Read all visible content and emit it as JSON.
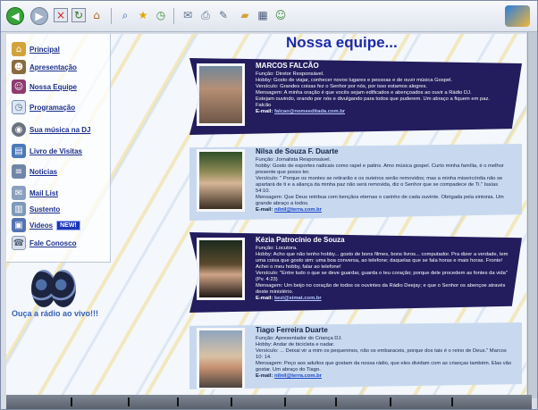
{
  "page": {
    "title": "Nossa equipe...",
    "radio_text": "Ouça a rádio ao vivo!!!"
  },
  "sidebar": {
    "items": [
      {
        "label": "Principal",
        "icon": "house-icon"
      },
      {
        "label": "Apresentação",
        "icon": "people-icon"
      },
      {
        "label": "Nossa Equipe",
        "icon": "team-icon"
      },
      {
        "label": "Programação",
        "icon": "schedule-icon"
      },
      {
        "label": "Sua música na DJ",
        "icon": "disc-icon"
      },
      {
        "label": "Livro de Visitas",
        "icon": "book-icon"
      },
      {
        "label": "Noticias",
        "icon": "news-icon"
      },
      {
        "label": "Mail List",
        "icon": "mail-icon"
      },
      {
        "label": "Sustento",
        "icon": "support-icon"
      },
      {
        "label": "Videos",
        "icon": "video-icon",
        "badge": "NEW!"
      },
      {
        "label": "Fale Conosco",
        "icon": "contact-icon"
      }
    ]
  },
  "team": [
    {
      "name": "MARCOS FALCÃO",
      "lines": [
        "Função: Diretor Responsável.",
        "Hobby: Gosto de viajar, conhecer novos lugares e pessoas e de ouvir música Gospel.",
        "Versículo: Grandes coisas fez o Senhor por nós, por isso estamos alegres.",
        "Mensagem: A minha oração é que vocês sejam edificados e abençoados ao ouvir a Rádio DJ.",
        "Estejam ouvindo, orando por nós e divulgando para todos que puderem. Um abraço a fiquem em paz.",
        "Falcão"
      ],
      "email": "falcao@nomeeditada.com.br"
    },
    {
      "name": "Nilsa de Souza F. Duarte",
      "lines": [
        "Função: Jornalista Responsável.",
        "hobby: Gosto de esportes radicais como rapel e patins. Amo música gospel. Curto minha família, é o melhor presente que posso ter.",
        "Versículo: \" Porque os montes se retirarão e os outeiros serão removidos; mas a minha misericórdia não se apartará de ti e a aliança da minha paz não será removida, diz o Senhor que se compadece de Ti.\" Isaías 54:10.",
        "Mensagem: Que Deus retribua com bençãos eternas o carinho de cada ouvinte. Obrigada pela sintonia. Um grande abraço a todos."
      ],
      "email": "nilnil@terra.com.br"
    },
    {
      "name": "Kézia Patrocínio de Souza",
      "lines": [
        "Função: Locutora.",
        "Hobby: Acho que não tenho hobby... gosto de bons filmes, bons livros... computador. Pra dizer a verdade, tem uma coisa que gosto sim: uma boa conversa, ao telefone; daquelas que se fala horas e mais horas. Fronte! Achei o meu hobby, falar ao telefone!",
        "Versículo: \"Entre tudo o que se deve guardar, guarda o teu coração; porque dele procedem as fontes da vida\" (Pv. 4:23)",
        "Mensagem: Um beijo no coração de todos os ouvintes da Rádio Deejay; e que o Senhor os abençoe através deste ministério."
      ],
      "email": "kezi@simat.com.br"
    },
    {
      "name": "Tiago Ferreira Duarte",
      "lines": [
        "Função: Apresentador do Criança DJ.",
        "Hobby: Andar de bicicleta e nadar.",
        "Versículo: ... Deixai vir a mim os pequeninos, não os embaraceis, porque dos tais é o reino de Deus.\" Marcos 10: 14.",
        "Mensagem: Peço aos adultos que gostam da nossa rádio, que eles dividam com as crianças também. Elas vão gostar. Um abraço do Tiago."
      ],
      "email": "nilnil@terra.com.br"
    }
  ],
  "toolbar": {
    "icons": [
      "back-icon",
      "forward-icon",
      "stop-icon",
      "refresh-icon",
      "home-icon",
      "search-icon",
      "favorites-icon",
      "history-icon",
      "mail-icon",
      "print-icon",
      "edit-icon",
      "folder-icon",
      "discuss-icon",
      "messenger-icon"
    ]
  },
  "colors": {
    "title": "#1b2aa8",
    "link": "#1b2f8d",
    "dark_card": "#231c5d",
    "light_card": "#c8d9ef"
  }
}
